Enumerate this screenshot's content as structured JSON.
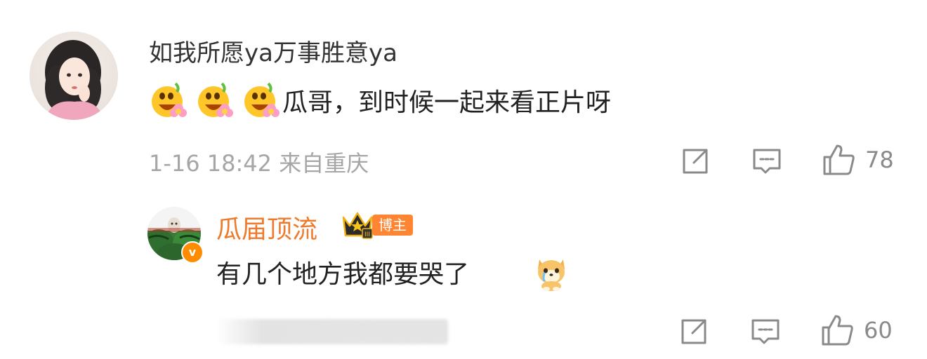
{
  "comment": {
    "username": "如我所愿ya万事胜意ya",
    "text": "瓜哥，到时候一起来看正片呀",
    "emoji_count": 3,
    "timestamp": "1-16 18:42 来自重庆",
    "likes": "78",
    "icons": [
      "share-icon",
      "comment-icon",
      "like-icon"
    ]
  },
  "reply": {
    "username": "瓜届顶流",
    "tag": "博主",
    "verified_mark": "v",
    "text": "有几个地方我都要哭了",
    "likes": "60",
    "icons": [
      "share-icon",
      "comment-icon",
      "like-icon"
    ]
  },
  "colors": {
    "username_reply": "#ee7a2c",
    "tag_bg": "#ff8532",
    "meta_gray": "#a6a6a6",
    "icon_gray": "#8a8a8a"
  }
}
